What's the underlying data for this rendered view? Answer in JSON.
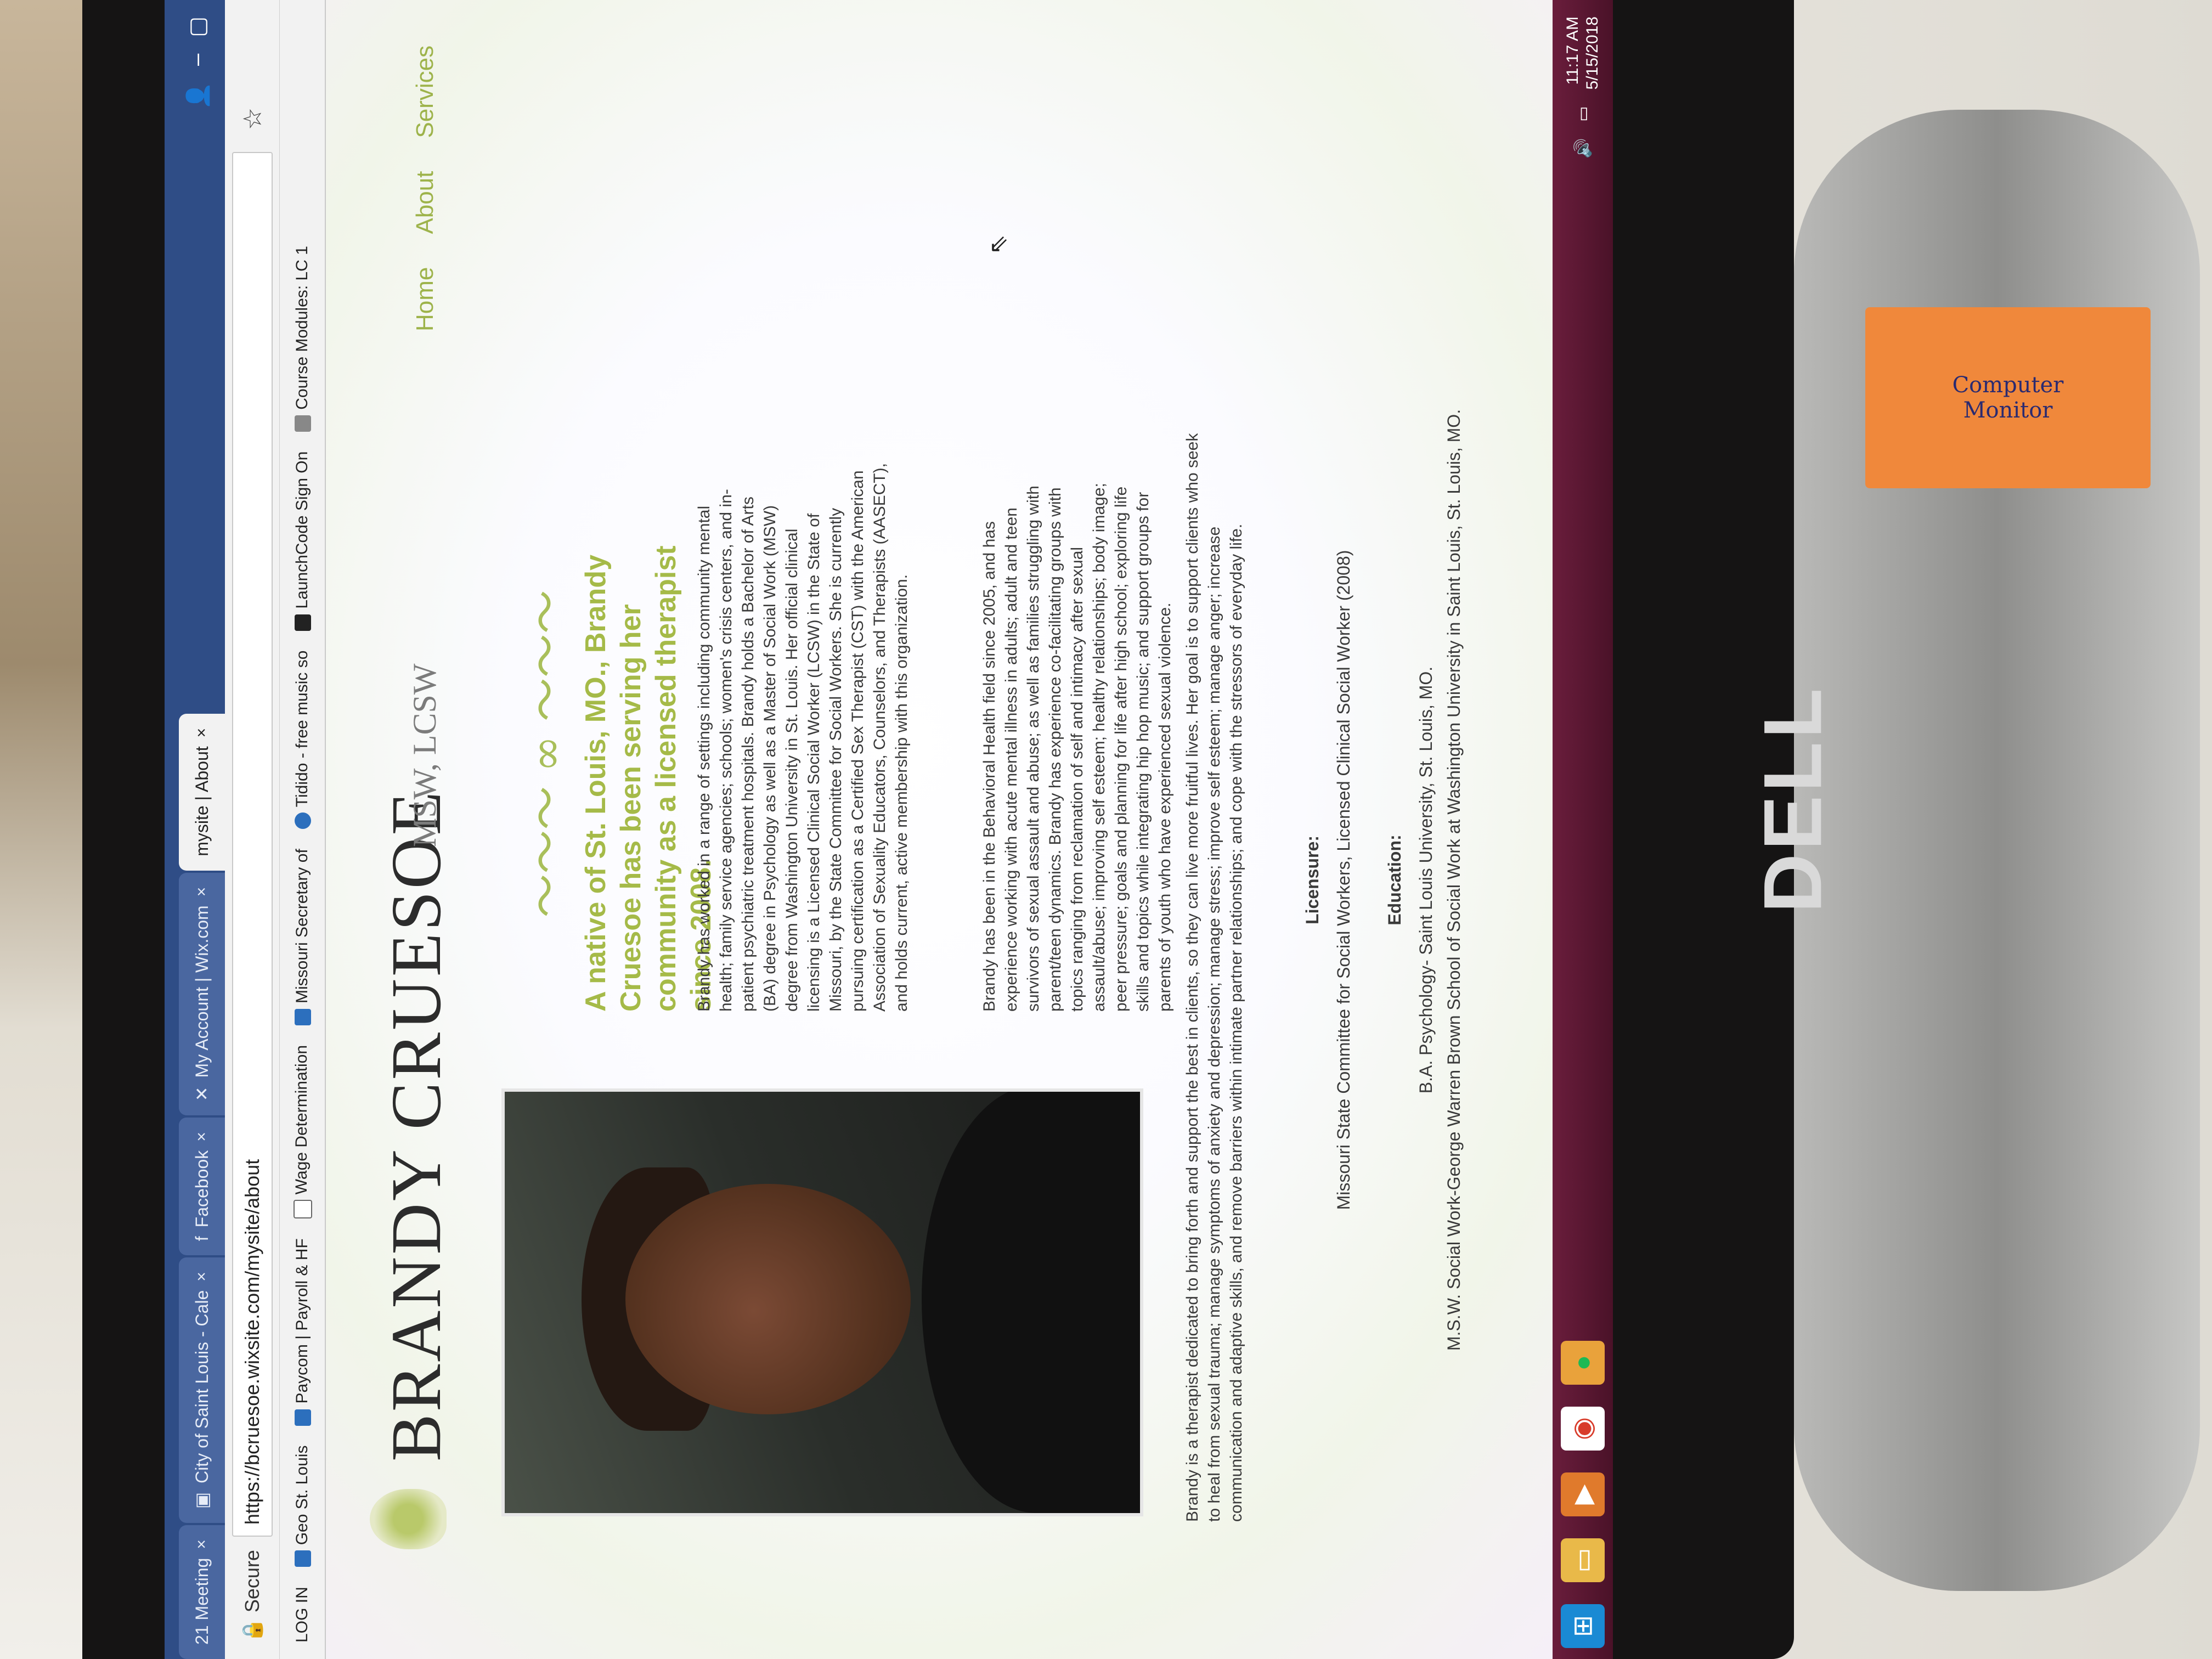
{
  "browser": {
    "tabs": [
      {
        "label": "21 Meeting",
        "active": false
      },
      {
        "label": "City of Saint Louis - Cale",
        "active": false
      },
      {
        "label": "Facebook",
        "active": false
      },
      {
        "label": "My Account | Wix.com",
        "active": false
      },
      {
        "label": "mysite | About",
        "active": true
      }
    ],
    "secure_label": "Secure",
    "url": "https://bcruesoe.wixsite.com/mysite/about",
    "bookmarks": [
      "LOG IN",
      "Geo St. Louis",
      "Paycom | Payroll & HF",
      "Wage Determination",
      "Missouri Secretary of",
      "Tidido - free music so",
      "LaunchCode Sign On",
      "Course Modules: LC 1"
    ]
  },
  "site": {
    "name": "BRANDY CRUESOE",
    "credentials": "MSW, LCSW",
    "nav": [
      "Home",
      "About",
      "Services"
    ],
    "headline": "A native of St. Louis, MO., Brandy Cruesoe has been serving her community as a licensed therapist since 2008.",
    "para1": "Brandy has worked in a range of settings including community mental health; family service agencies; schools; women's crisis centers, and in-patient psychiatric treatment hospitals. Brandy holds a Bachelor of Arts (BA) degree in Psychology as well as a Master of Social Work (MSW) degree from Washington University in St. Louis. Her official clinical licensing is a Licensed Clinical Social Worker (LCSW) in the State of Missouri, by the State Committee for Social Workers. She is currently pursuing certification as a Certified Sex Therapist (CST) with the American Association of Sexuality Educators, Counselors, and Therapists (AASECT), and holds current, active membership with this organization.",
    "para2": "Brandy has been in the Behavioral Health field since 2005, and has experience working with acute mental illness in adults; adult and teen survivors of sexual assault and abuse; as well as families struggling with parent/teen dynamics. Brandy has experience co-facilitating groups with topics ranging from reclamation of self and intimacy after sexual assault/abuse; improving self esteem; healthy relationships; body image; peer pressure; goals and planning for life after high school; exploring life skills and topics while integrating hip hop music; and support groups for parents of youth who have experienced sexual violence.",
    "para3": "Brandy is a therapist dedicated to bring forth and support the best in clients, so they can live more fruitful lives. Her goal is to support clients who seek to heal from sexual trauma; manage symptoms of anxiety and depression; manage stress; improve self esteem; manage anger; increase communication and adaptive skills, and remove barriers within intimate partner relationships; and cope with the stressors of everyday life.",
    "licensure_heading": "Licensure:",
    "licensure": "Missouri State Committee for Social Workers, Licensed Clinical Social Worker (2008)",
    "education_heading": "Education:",
    "education": [
      "B.A. Psychology- Saint Louis University, St. Louis, MO.",
      "M.S.W. Social Work-George Warren Brown School of Social Work at Washington University in Saint Louis, St. Louis, MO."
    ]
  },
  "taskbar": {
    "time": "11:17 AM",
    "date": "5/15/2018"
  },
  "hardware": {
    "monitor_brand": "DELL",
    "sticker_lines": [
      "Computer",
      "Monitor"
    ]
  },
  "colors": {
    "accent": "#a5ba48",
    "tab_bar": "#2f4d86",
    "taskbar": "#6a1d3c"
  }
}
